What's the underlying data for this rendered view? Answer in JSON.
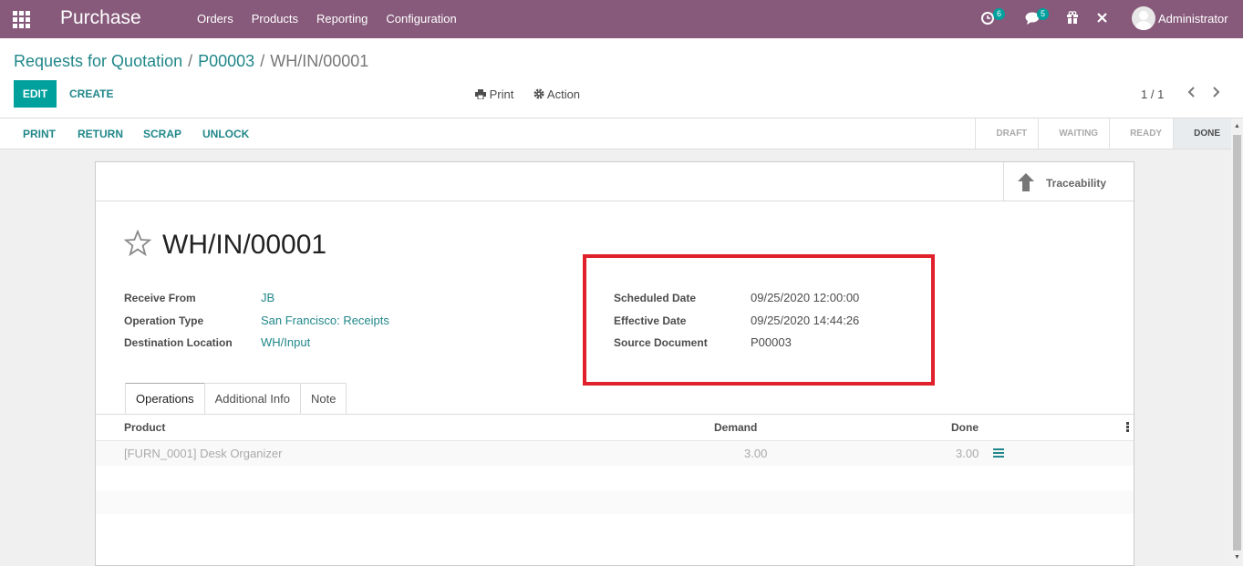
{
  "navbar": {
    "brand": "Purchase",
    "menu": [
      "Orders",
      "Products",
      "Reporting",
      "Configuration"
    ],
    "activity_count": "6",
    "messages_count": "5",
    "user": "Administrator"
  },
  "breadcrumb": {
    "items": [
      "Requests for Quotation",
      "P00003"
    ],
    "current": "WH/IN/00001",
    "separator": "/"
  },
  "toolbar": {
    "edit_label": "EDIT",
    "create_label": "CREATE",
    "print_label": "Print",
    "action_label": "Action",
    "pager": "1 / 1"
  },
  "statusbar": {
    "buttons": [
      "PRINT",
      "RETURN",
      "SCRAP",
      "UNLOCK"
    ],
    "stages": [
      "DRAFT",
      "WAITING",
      "READY",
      "DONE"
    ],
    "active_stage": "DONE"
  },
  "sheet": {
    "traceability_label": "Traceability",
    "title": "WH/IN/00001",
    "left_fields": [
      {
        "label": "Receive From",
        "value": "JB"
      },
      {
        "label": "Operation Type",
        "value": "San Francisco: Receipts"
      },
      {
        "label": "Destination Location",
        "value": "WH/Input"
      }
    ],
    "right_fields": [
      {
        "label": "Scheduled Date",
        "value": "09/25/2020 12:00:00"
      },
      {
        "label": "Effective Date",
        "value": "09/25/2020 14:44:26"
      },
      {
        "label": "Source Document",
        "value": "P00003"
      }
    ],
    "tabs": [
      "Operations",
      "Additional Info",
      "Note"
    ],
    "active_tab": "Operations",
    "table": {
      "headers": [
        "Product",
        "Demand",
        "Done"
      ],
      "rows": [
        {
          "product": "[FURN_0001] Desk Organizer",
          "demand": "3.00",
          "done": "3.00"
        }
      ]
    }
  },
  "colors": {
    "navbar": "#875a7b",
    "accent": "#00a09d",
    "link": "#21878a",
    "highlight": "#e0202a"
  }
}
